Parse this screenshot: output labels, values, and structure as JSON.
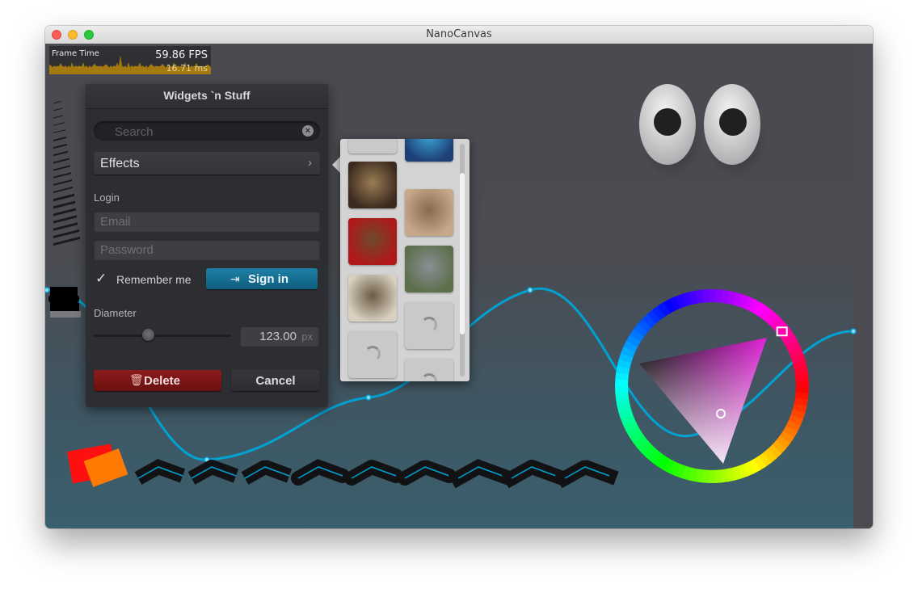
{
  "window": {
    "title": "NanoCanvas"
  },
  "perf_graph": {
    "label": "Frame Time",
    "fps": "59.86 FPS",
    "ms": "16.71 ms"
  },
  "widgets_panel": {
    "title": "Widgets `n Stuff",
    "search": {
      "placeholder": "Search",
      "clear_icon": "close-circle-icon"
    },
    "dropdown": {
      "label": "Effects"
    },
    "login": {
      "section_label": "Login",
      "email_placeholder": "Email",
      "password_placeholder": "Password",
      "remember_label": "Remember me",
      "remember_checked": true,
      "sign_in_label": "Sign in"
    },
    "diameter": {
      "label": "Diameter",
      "value": "123.00",
      "unit": "px",
      "slider_fraction": 0.4
    },
    "buttons": {
      "delete_label": "Delete",
      "cancel_label": "Cancel"
    }
  },
  "thumbnails": [
    {
      "name": "thumb-loading-bar"
    },
    {
      "name": "thumb-jellyfish",
      "colors": [
        "#1d3f74",
        "#3aa3d8"
      ]
    },
    {
      "name": "thumb-shrew",
      "colors": [
        "#3b2a1e",
        "#9a7d55"
      ]
    },
    {
      "name": "thumb-bunny",
      "colors": [
        "#c8a88a",
        "#8a6a4f"
      ]
    },
    {
      "name": "thumb-cat-hat",
      "colors": [
        "#b01818",
        "#6c4a2c"
      ]
    },
    {
      "name": "thumb-baby-animal",
      "colors": [
        "#5c6f4b",
        "#8a8e94"
      ]
    },
    {
      "name": "thumb-turtle",
      "colors": [
        "#d8d0c0",
        "#6b5a43"
      ]
    },
    {
      "name": "thumb-loading",
      "colors": []
    },
    {
      "name": "thumb-loading",
      "colors": []
    },
    {
      "name": "thumb-loading",
      "colors": []
    }
  ],
  "colors": {
    "accent_line": "#00a2d2",
    "sign_in": "#1a7aa0",
    "delete": "#7f1515",
    "color_picker_selected": "#e03ad6"
  }
}
